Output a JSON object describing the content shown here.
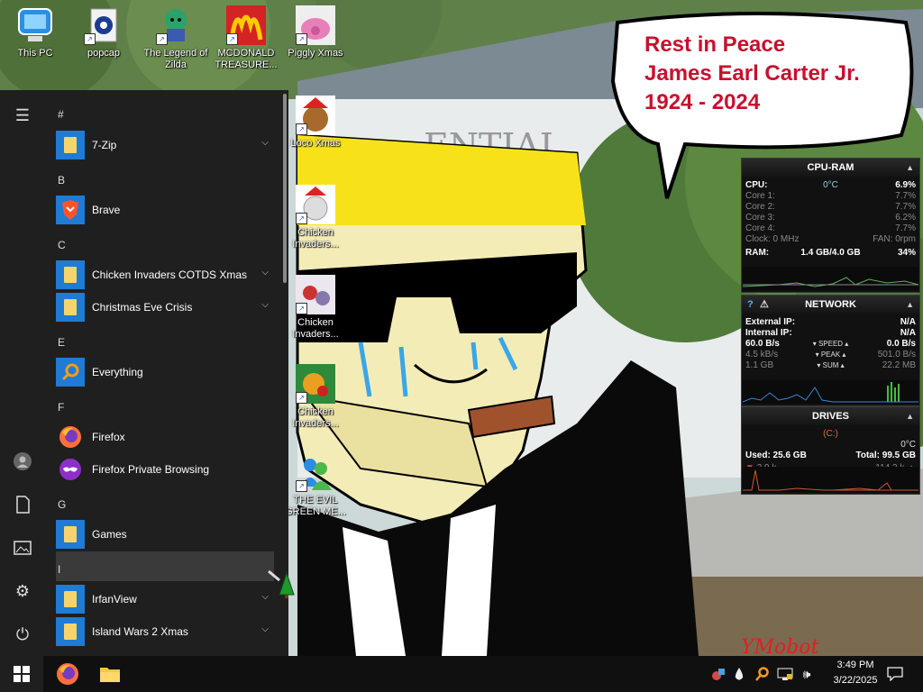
{
  "desktop": {
    "icons": [
      {
        "label": "This PC",
        "icon": "computer-icon"
      },
      {
        "label": "popcap",
        "icon": "popcap-icon"
      },
      {
        "label": "The Legend of Zilda",
        "icon": "legend-of-zilda-icon"
      },
      {
        "label": "MCDONALD TREASURE...",
        "icon": "mcdonald-icon"
      },
      {
        "label": "Piggly Xmas",
        "icon": "piggly-xmas-icon"
      },
      {
        "label": "Loco Xmas",
        "icon": "loco-xmas-icon"
      },
      {
        "label": "Chicken Invaders...",
        "icon": "chicken-invaders-icon"
      },
      {
        "label": "Chicken Invaders...",
        "icon": "chicken-invaders-icon"
      },
      {
        "label": "Chicken Invaders...",
        "icon": "chicken-invaders-icon"
      },
      {
        "label": "THE EVIL GREEN ME...",
        "icon": "messenger-icon"
      }
    ],
    "bubble": {
      "line1": "Rest in Peace",
      "line2": "James Earl Carter Jr.",
      "line3": "1924 - 2024"
    },
    "building_sign": "ENTIAL",
    "watermark": "YMobot"
  },
  "start_menu": {
    "headers": [
      "#",
      "B",
      "C",
      "E",
      "F",
      "G",
      "I"
    ],
    "apps": [
      {
        "name": "7-Zip",
        "icon": "folder-icon",
        "expandable": true
      },
      {
        "name": "Brave",
        "icon": "brave-icon",
        "expandable": false
      },
      {
        "name": "Chicken Invaders COTDS Xmas",
        "icon": "folder-icon",
        "expandable": true
      },
      {
        "name": "Christmas Eve Crisis",
        "icon": "folder-icon",
        "expandable": true
      },
      {
        "name": "Everything",
        "icon": "search-icon",
        "expandable": false
      },
      {
        "name": "Firefox",
        "icon": "firefox-icon",
        "expandable": false
      },
      {
        "name": "Firefox Private Browsing",
        "icon": "firefox-private-icon",
        "expandable": false
      },
      {
        "name": "Games",
        "icon": "folder-icon",
        "expandable": false
      },
      {
        "name": "IrfanView",
        "icon": "folder-icon",
        "expandable": true
      },
      {
        "name": "Island Wars 2 Xmas",
        "icon": "folder-icon",
        "expandable": true
      }
    ],
    "rail": [
      "hamburger-icon",
      "user-icon",
      "documents-icon",
      "pictures-icon",
      "settings-icon",
      "power-icon"
    ]
  },
  "widgets": {
    "cpu": {
      "title": "CPU-RAM",
      "cpu_label": "CPU:",
      "temp": "0°C",
      "cpu_value": "6.9%",
      "cores": [
        {
          "label": "Core 1:",
          "value": "7.7%"
        },
        {
          "label": "Core 2:",
          "value": "7.7%"
        },
        {
          "label": "Core 3:",
          "value": "6.2%"
        },
        {
          "label": "Core 4:",
          "value": "7.7%"
        }
      ],
      "clock": "Clock: 0 MHz",
      "fan": "FAN: 0rpm",
      "ram_label": "RAM:",
      "ram_value": "1.4 GB/4.0 GB",
      "ram_pct": "34%"
    },
    "network": {
      "title": "NETWORK",
      "ext_label": "External IP:",
      "ext_value": "N/A",
      "int_label": "Internal IP:",
      "int_value": "N/A",
      "speed_down": "60.0 B/s",
      "speed_label": "SPEED",
      "speed_up": "0.0 B/s",
      "peak_down": "4.5 kB/s",
      "peak_label": "PEAK",
      "peak_up": "501.0 B/s",
      "sum_down": "1.1 GB",
      "sum_label": "SUM",
      "sum_up": "22.2 MB"
    },
    "drives": {
      "title": "DRIVES",
      "drive": "(C:)",
      "temp": "0°C",
      "used": "Used: 25.6 GB",
      "total": "Total: 99.5 GB",
      "read": "3.9 k",
      "write": "114.3 k"
    }
  },
  "taskbar": {
    "time": "3:49 PM",
    "date": "3/22/2025"
  },
  "colors": {
    "bubble_text": "#c8102e",
    "folder": "#1f7bd4",
    "menu_bg": "#1f1f1f"
  }
}
